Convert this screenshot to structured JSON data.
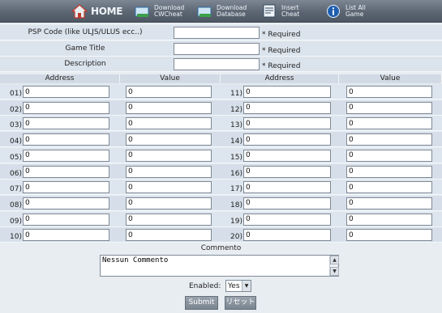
{
  "nav": {
    "home": "HOME",
    "download_cwcheat": [
      "Download",
      "CWCheat"
    ],
    "download_database": [
      "Download",
      "Database"
    ],
    "insert_cheat": [
      "Insert",
      "Cheat"
    ],
    "list_all_game": [
      "List All",
      "Game"
    ]
  },
  "fields": [
    {
      "label": "PSP Code (like ULJS/ULUS ecc..)",
      "value": "",
      "note": "* Required"
    },
    {
      "label": "Game Title",
      "value": "",
      "note": "* Required"
    },
    {
      "label": "Description",
      "value": "",
      "note": "* Required"
    }
  ],
  "grid": {
    "headers": [
      "Address",
      "Value",
      "Address",
      "Value"
    ],
    "left_rows": [
      {
        "num": "01)",
        "address": "0",
        "value": "0"
      },
      {
        "num": "02)",
        "address": "0",
        "value": "0"
      },
      {
        "num": "03)",
        "address": "0",
        "value": "0"
      },
      {
        "num": "04)",
        "address": "0",
        "value": "0"
      },
      {
        "num": "05)",
        "address": "0",
        "value": "0"
      },
      {
        "num": "06)",
        "address": "0",
        "value": "0"
      },
      {
        "num": "07)",
        "address": "0",
        "value": "0"
      },
      {
        "num": "08)",
        "address": "0",
        "value": "0"
      },
      {
        "num": "09)",
        "address": "0",
        "value": "0"
      },
      {
        "num": "10)",
        "address": "0",
        "value": "0"
      }
    ],
    "right_rows": [
      {
        "num": "11)",
        "address": "0",
        "value": "0"
      },
      {
        "num": "12)",
        "address": "0",
        "value": "0"
      },
      {
        "num": "13)",
        "address": "0",
        "value": "0"
      },
      {
        "num": "14)",
        "address": "0",
        "value": "0"
      },
      {
        "num": "15)",
        "address": "0",
        "value": "0"
      },
      {
        "num": "16)",
        "address": "0",
        "value": "0"
      },
      {
        "num": "17)",
        "address": "0",
        "value": "0"
      },
      {
        "num": "18)",
        "address": "0",
        "value": "0"
      },
      {
        "num": "19)",
        "address": "0",
        "value": "0"
      },
      {
        "num": "20)",
        "address": "0",
        "value": "0"
      }
    ]
  },
  "commento": {
    "label": "Commento",
    "value": "Nessun Commento"
  },
  "enabled": {
    "label": "Enabled:",
    "value": "Yes"
  },
  "buttons": {
    "submit": "Submit",
    "reset": "リセット"
  },
  "icons": {
    "home": "house-icon",
    "cwcheat": "download-icon",
    "database": "database-icon",
    "insert": "insert-icon",
    "list": "info-icon"
  }
}
